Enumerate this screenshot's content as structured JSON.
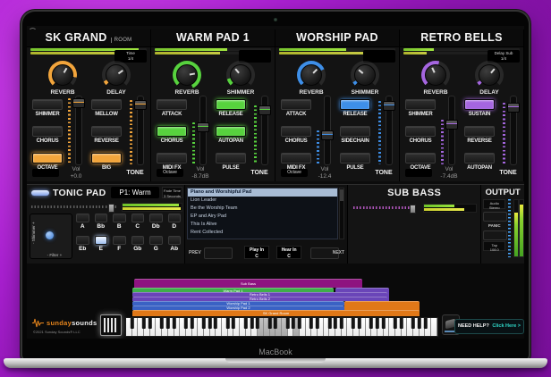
{
  "device": {
    "brand": "MacBook"
  },
  "channels": [
    {
      "name": "SK GRAND",
      "suffix": "ROOM",
      "accent": "#f2a53c",
      "meters": [
        "93%",
        "100%"
      ],
      "info": [
        "Time",
        "1/4"
      ],
      "knobs": [
        {
          "label": "REVERB",
          "arc": "235deg",
          "rot": "30deg"
        },
        {
          "label": "DELAY",
          "arc": "18deg",
          "rot": "55deg"
        }
      ],
      "bl": [
        {
          "label": "SHIMMER",
          "state": "off"
        },
        {
          "label": "CHORUS",
          "state": "off"
        },
        {
          "label": "OCTAVE",
          "state": "on"
        }
      ],
      "br": [
        {
          "label": "MELLOW",
          "state": "off"
        },
        {
          "label": "REVERSE",
          "state": "off"
        },
        {
          "label": "BIG",
          "state": "on"
        }
      ],
      "oct": "",
      "vol_label": "Vol",
      "vol_value": "+0.0",
      "tone_label": "TONE",
      "vol_top": "4%",
      "tone_top": "6%"
    },
    {
      "name": "WARM PAD 1",
      "suffix": "",
      "accent": "#57d23e",
      "meters": [
        "62%",
        "56%"
      ],
      "info": [
        "",
        ""
      ],
      "knobs": [
        {
          "label": "REVERB",
          "arc": "290deg",
          "rot": "80deg"
        },
        {
          "label": "SHIMMER",
          "arc": "28deg",
          "rot": "-40deg"
        }
      ],
      "bl": [
        {
          "label": "ATTACK",
          "state": "off"
        },
        {
          "label": "CHORUS",
          "state": "on"
        },
        {
          "label": "MIDI FX",
          "state": "off"
        }
      ],
      "br": [
        {
          "label": "RELEASE",
          "state": "on"
        },
        {
          "label": "AUTOPAN",
          "state": "on"
        },
        {
          "label": "PULSE",
          "state": "off"
        }
      ],
      "oct": "Octave",
      "vol_label": "Vol",
      "vol_value": "-8.7dB",
      "tone_label": "TONE",
      "vol_top": "38%",
      "tone_top": "14%"
    },
    {
      "name": "WORSHIP PAD",
      "suffix": "",
      "accent": "#3e8fe8",
      "meters": [
        "58%",
        "72%"
      ],
      "info": [
        "",
        ""
      ],
      "knobs": [
        {
          "label": "REVERB",
          "arc": "200deg",
          "rot": "45deg"
        },
        {
          "label": "SHIMMER",
          "arc": "14deg",
          "rot": "-50deg"
        }
      ],
      "bl": [
        {
          "label": "ATTACK",
          "state": "off"
        },
        {
          "label": "CHORUS",
          "state": "off"
        },
        {
          "label": "MIDI FX",
          "state": "off"
        }
      ],
      "br": [
        {
          "label": "RELEASE",
          "state": "on"
        },
        {
          "label": "SIDECHAIN",
          "state": "off"
        },
        {
          "label": "PULSE",
          "state": "off"
        }
      ],
      "oct": "Octave",
      "vol_label": "Vol",
      "vol_value": "-12.4",
      "tone_label": "TONE",
      "vol_top": "50%",
      "tone_top": "8%"
    },
    {
      "name": "RETRO BELLS",
      "suffix": "",
      "accent": "#a566e0",
      "meters": [
        "26%",
        "20%"
      ],
      "info": [
        "Delay Sub",
        "1/4"
      ],
      "knobs": [
        {
          "label": "REVERB",
          "arc": "150deg",
          "rot": "-25deg"
        },
        {
          "label": "DELAY",
          "arc": "14deg",
          "rot": "40deg"
        }
      ],
      "bl": [
        {
          "label": "SHIMMER",
          "state": "off"
        },
        {
          "label": "CHORUS",
          "state": "off"
        },
        {
          "label": "OCTAVE",
          "state": "off"
        }
      ],
      "br": [
        {
          "label": "SUSTAIN",
          "state": "on"
        },
        {
          "label": "REVERSE",
          "state": "off"
        },
        {
          "label": "AUTOPAN",
          "state": "off"
        }
      ],
      "oct": "",
      "vol_label": "Vol",
      "vol_value": "-7.4dB",
      "tone_label": "TONE",
      "vol_top": "34%",
      "tone_top": "10%"
    }
  ],
  "tonic": {
    "title": "TONIC PAD",
    "patch": "P1: Warm",
    "fade": [
      "Fade Time",
      "3 Seconds"
    ],
    "slider_pos": "90%",
    "meters": [
      "96%",
      "98%"
    ],
    "xy_y_label": "- Shimmer +",
    "xy_x_label": "- Filter +",
    "notes": [
      {
        "label": "A",
        "state": "off"
      },
      {
        "label": "Bb",
        "state": "off"
      },
      {
        "label": "B",
        "state": "off"
      },
      {
        "label": "C",
        "state": "off"
      },
      {
        "label": "Db",
        "state": "off"
      },
      {
        "label": "D",
        "state": "off"
      },
      {
        "label": "Eb",
        "state": "off"
      },
      {
        "label": "E",
        "state": "on"
      },
      {
        "label": "F",
        "state": "off"
      },
      {
        "label": "Gb",
        "state": "off"
      },
      {
        "label": "G",
        "state": "off"
      },
      {
        "label": "Ab",
        "state": "off"
      }
    ]
  },
  "setlist": {
    "songs": [
      {
        "title": "Piano and Worshipful Pad",
        "selected": "true"
      },
      {
        "title": "Lion Leader",
        "selected": "false"
      },
      {
        "title": "Be the Worship Team",
        "selected": "false"
      },
      {
        "title": "EP and Airy Pad",
        "selected": "false"
      },
      {
        "title": "This Is Alive",
        "selected": "false"
      },
      {
        "title": "Rent Collected",
        "selected": "false"
      }
    ],
    "prev_label": "PREV",
    "next_label": "NEXT",
    "play_in": [
      "Play In",
      "C"
    ],
    "hear_in": [
      "Hear In",
      "C"
    ]
  },
  "subbass": {
    "title": "SUB BASS",
    "accent": "#cd61dc",
    "slider_pos": "90%",
    "meters": [
      "58%",
      "78%"
    ]
  },
  "output": {
    "title": "OUTPUT",
    "audio": [
      "Audio",
      "Stereo"
    ],
    "panic_label": "PANIC",
    "tap": [
      "Tap",
      "108.0"
    ],
    "meter1": "78%",
    "meter2": "92%"
  },
  "zones": [
    {
      "label": "Sub Bass",
      "color": "#8e1380"
    },
    {
      "label": "Warm Pad 1",
      "color": "#3fae4a"
    },
    {
      "label": "Retro Bells 1",
      "color": "#6a45b8"
    },
    {
      "label": "Retro Bells 2",
      "color": "#6a45b8"
    },
    {
      "label": "Worship Pad 1",
      "color": "#3a62c4"
    },
    {
      "label": "Worship Pad 2",
      "color": "#3a62c4"
    },
    {
      "label": "SK Grand Room",
      "color": "#e07818"
    }
  ],
  "keyboard": {
    "white_keys": 52,
    "pressed": [
      22,
      23,
      24,
      25,
      26,
      28
    ]
  },
  "footer": {
    "logo_primary": "sunday",
    "logo_secondary": "sounds",
    "copyright": "©2021 Sunday Sounds® LLC",
    "help_text": "NEED HELP?",
    "help_link": "Click Here >"
  }
}
